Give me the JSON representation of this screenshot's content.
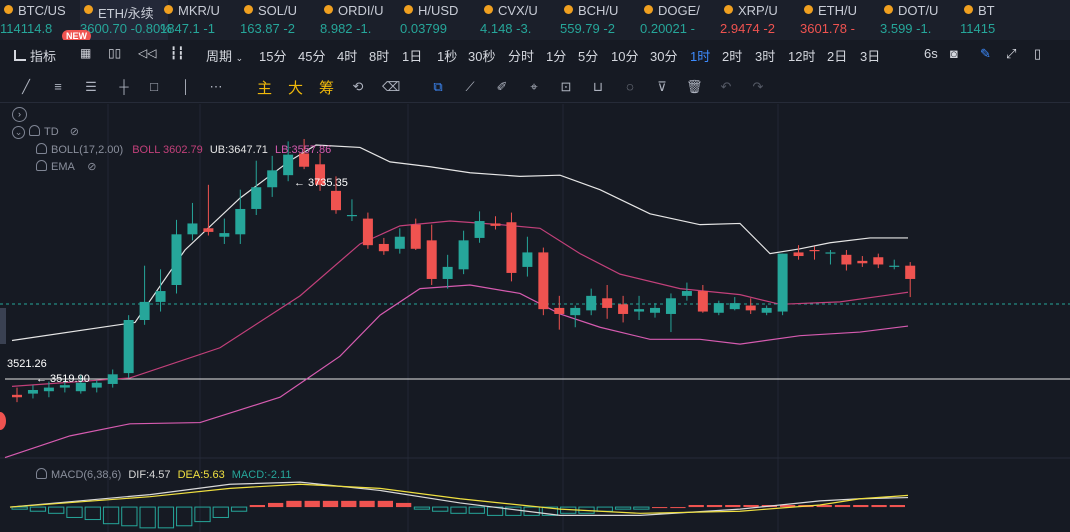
{
  "tickers": [
    {
      "name": "BTC/US",
      "price": "114114.8",
      "change": "",
      "color": "up",
      "active": false
    },
    {
      "name": "ETH/永续",
      "price": "3600.70",
      "change": "-0.80%",
      "color": "up",
      "active": true
    },
    {
      "name": "MKR/U",
      "price": "1847.1",
      "change": "-1",
      "color": "up",
      "active": false
    },
    {
      "name": "SOL/U",
      "price": "163.87",
      "change": "-2",
      "color": "up",
      "active": false
    },
    {
      "name": "ORDI/U",
      "price": "8.982",
      "change": "-1.",
      "color": "up",
      "active": false
    },
    {
      "name": "H/USD",
      "price": "0.03799",
      "change": "",
      "color": "up",
      "active": false
    },
    {
      "name": "CVX/U",
      "price": "4.148",
      "change": "-3.",
      "color": "up",
      "active": false
    },
    {
      "name": "BCH/U",
      "price": "559.79",
      "change": "-2",
      "color": "up",
      "active": false
    },
    {
      "name": "DOGE/",
      "price": "0.20021",
      "change": "-",
      "color": "up",
      "active": false
    },
    {
      "name": "XRP/U",
      "price": "2.9474",
      "change": "-2",
      "color": "dn",
      "active": false
    },
    {
      "name": "ETH/U",
      "price": "3601.78",
      "change": "-",
      "color": "dn",
      "active": false
    },
    {
      "name": "DOT/U",
      "price": "3.599",
      "change": "-1.",
      "color": "up",
      "active": false
    },
    {
      "name": "BT",
      "price": "11415",
      "change": "",
      "color": "up",
      "active": false
    }
  ],
  "new_badge": "NEW",
  "toolbar": {
    "indicators": "指标",
    "period": "周期",
    "intervals": [
      "15分",
      "45分",
      "4时",
      "8时",
      "1日",
      "1秒",
      "30秒",
      "分时",
      "1分",
      "5分",
      "10分",
      "30分",
      "1时",
      "2时",
      "3时",
      "12时",
      "2日",
      "3日"
    ],
    "selected": "1时",
    "refresh": "6s"
  },
  "drawbar": {
    "zhu": "主",
    "da": "大",
    "chou": "筹"
  },
  "legend": {
    "td": "TD",
    "boll_label": "BOLL(17,2.00)",
    "boll_value": "BOLL 3602.79",
    "ub": "UB:3647.71",
    "lb": "LB:3557.86",
    "ema": "EMA",
    "macd_label": "MACD(6,38,6)",
    "dif": "DIF:4.57",
    "dea": "DEA:5.63",
    "macd": "MACD:-2.11"
  },
  "annotations": {
    "high": "← 3735.35",
    "low": "← 3519.90",
    "price_left": "3521.26"
  },
  "colors": {
    "up": "#26a69a",
    "down": "#ef5350",
    "boll_mid": "#c2407a",
    "boll_lb": "#d65bb0",
    "boll_ub": "#e6e6e6",
    "dea": "#f0e040",
    "dif": "#d9d9d9",
    "accent": "#3d8bfd"
  },
  "chart_data": {
    "type": "candlestick",
    "candles": [
      {
        "o": 3524,
        "h": 3530,
        "l": 3518,
        "c": 3522
      },
      {
        "o": 3525,
        "h": 3532,
        "l": 3521,
        "c": 3528
      },
      {
        "o": 3527,
        "h": 3535,
        "l": 3522,
        "c": 3530
      },
      {
        "o": 3530,
        "h": 3536,
        "l": 3526,
        "c": 3532
      },
      {
        "o": 3527,
        "h": 3540,
        "l": 3525,
        "c": 3534
      },
      {
        "o": 3530,
        "h": 3536,
        "l": 3526,
        "c": 3534
      },
      {
        "o": 3533,
        "h": 3545,
        "l": 3530,
        "c": 3541
      },
      {
        "o": 3542,
        "h": 3590,
        "l": 3538,
        "c": 3586
      },
      {
        "o": 3586,
        "h": 3631,
        "l": 3582,
        "c": 3601
      },
      {
        "o": 3601,
        "h": 3628,
        "l": 3593,
        "c": 3610
      },
      {
        "o": 3615,
        "h": 3669,
        "l": 3608,
        "c": 3657
      },
      {
        "o": 3657,
        "h": 3683,
        "l": 3652,
        "c": 3666
      },
      {
        "o": 3662,
        "h": 3698,
        "l": 3656,
        "c": 3659
      },
      {
        "o": 3655,
        "h": 3670,
        "l": 3649,
        "c": 3658
      },
      {
        "o": 3657,
        "h": 3694,
        "l": 3649,
        "c": 3678
      },
      {
        "o": 3678,
        "h": 3718,
        "l": 3673,
        "c": 3696
      },
      {
        "o": 3696,
        "h": 3722,
        "l": 3688,
        "c": 3710
      },
      {
        "o": 3706,
        "h": 3734,
        "l": 3701,
        "c": 3723
      },
      {
        "o": 3724,
        "h": 3736,
        "l": 3711,
        "c": 3713
      },
      {
        "o": 3715,
        "h": 3724,
        "l": 3693,
        "c": 3698
      },
      {
        "o": 3693,
        "h": 3705,
        "l": 3674,
        "c": 3677
      },
      {
        "o": 3672,
        "h": 3686,
        "l": 3668,
        "c": 3673
      },
      {
        "o": 3670,
        "h": 3675,
        "l": 3645,
        "c": 3648
      },
      {
        "o": 3649,
        "h": 3654,
        "l": 3640,
        "c": 3643
      },
      {
        "o": 3645,
        "h": 3662,
        "l": 3641,
        "c": 3655
      },
      {
        "o": 3665,
        "h": 3670,
        "l": 3644,
        "c": 3645
      },
      {
        "o": 3652,
        "h": 3665,
        "l": 3615,
        "c": 3620
      },
      {
        "o": 3620,
        "h": 3640,
        "l": 3612,
        "c": 3630
      },
      {
        "o": 3628,
        "h": 3660,
        "l": 3624,
        "c": 3652
      },
      {
        "o": 3654,
        "h": 3676,
        "l": 3650,
        "c": 3668
      },
      {
        "o": 3666,
        "h": 3672,
        "l": 3661,
        "c": 3664
      },
      {
        "o": 3667,
        "h": 3675,
        "l": 3618,
        "c": 3625
      },
      {
        "o": 3630,
        "h": 3655,
        "l": 3622,
        "c": 3642
      },
      {
        "o": 3642,
        "h": 3646,
        "l": 3590,
        "c": 3595
      },
      {
        "o": 3596,
        "h": 3606,
        "l": 3578,
        "c": 3591
      },
      {
        "o": 3590,
        "h": 3598,
        "l": 3580,
        "c": 3596
      },
      {
        "o": 3594,
        "h": 3612,
        "l": 3590,
        "c": 3606
      },
      {
        "o": 3604,
        "h": 3615,
        "l": 3587,
        "c": 3596
      },
      {
        "o": 3599,
        "h": 3606,
        "l": 3584,
        "c": 3591
      },
      {
        "o": 3593,
        "h": 3606,
        "l": 3586,
        "c": 3595
      },
      {
        "o": 3592,
        "h": 3600,
        "l": 3588,
        "c": 3596
      },
      {
        "o": 3591,
        "h": 3608,
        "l": 3576,
        "c": 3604
      },
      {
        "o": 3606,
        "h": 3617,
        "l": 3602,
        "c": 3610
      },
      {
        "o": 3610,
        "h": 3615,
        "l": 3592,
        "c": 3593
      },
      {
        "o": 3592,
        "h": 3602,
        "l": 3590,
        "c": 3600
      },
      {
        "o": 3595,
        "h": 3605,
        "l": 3594,
        "c": 3600
      },
      {
        "o": 3598,
        "h": 3604,
        "l": 3591,
        "c": 3594
      },
      {
        "o": 3592,
        "h": 3598,
        "l": 3590,
        "c": 3596
      },
      {
        "o": 3593,
        "h": 3641,
        "l": 3590,
        "c": 3641
      },
      {
        "o": 3642,
        "h": 3648,
        "l": 3636,
        "c": 3639
      },
      {
        "o": 3644,
        "h": 3647,
        "l": 3636,
        "c": 3643
      },
      {
        "o": 3641,
        "h": 3644,
        "l": 3632,
        "c": 3642
      },
      {
        "o": 3640,
        "h": 3644,
        "l": 3627,
        "c": 3632
      },
      {
        "o": 3635,
        "h": 3639,
        "l": 3630,
        "c": 3633
      },
      {
        "o": 3638,
        "h": 3641,
        "l": 3629,
        "c": 3632
      },
      {
        "o": 3630,
        "h": 3636,
        "l": 3628,
        "c": 3631
      },
      {
        "o": 3631,
        "h": 3634,
        "l": 3605,
        "c": 3620
      }
    ],
    "boll_ub": [
      [
        12,
        3569
      ],
      [
        135,
        3584
      ],
      [
        185,
        3644
      ],
      [
        240,
        3687
      ],
      [
        290,
        3718
      ],
      [
        316,
        3731
      ],
      [
        360,
        3729
      ],
      [
        390,
        3717
      ],
      [
        430,
        3713
      ],
      [
        470,
        3708
      ],
      [
        520,
        3705
      ],
      [
        560,
        3706
      ],
      [
        600,
        3694
      ],
      [
        650,
        3674
      ],
      [
        700,
        3665
      ],
      [
        740,
        3666
      ],
      [
        770,
        3641
      ],
      [
        800,
        3645
      ],
      [
        830,
        3650
      ],
      [
        870,
        3654
      ],
      [
        908,
        3654
      ]
    ],
    "boll_mid": [
      [
        12,
        3531
      ],
      [
        130,
        3538
      ],
      [
        220,
        3563
      ],
      [
        300,
        3606
      ],
      [
        360,
        3649
      ],
      [
        400,
        3664
      ],
      [
        450,
        3668
      ],
      [
        500,
        3665
      ],
      [
        540,
        3662
      ],
      [
        580,
        3641
      ],
      [
        620,
        3624
      ],
      [
        680,
        3612
      ],
      [
        740,
        3607
      ],
      [
        780,
        3599
      ],
      [
        840,
        3601
      ],
      [
        908,
        3609
      ]
    ],
    "boll_lb": [
      [
        5,
        3472
      ],
      [
        70,
        3490
      ],
      [
        130,
        3500
      ],
      [
        200,
        3501
      ],
      [
        280,
        3522
      ],
      [
        340,
        3556
      ],
      [
        380,
        3590
      ],
      [
        420,
        3612
      ],
      [
        470,
        3615
      ],
      [
        520,
        3608
      ],
      [
        560,
        3591
      ],
      [
        600,
        3580
      ],
      [
        650,
        3570
      ],
      [
        700,
        3570
      ],
      [
        740,
        3566
      ],
      [
        800,
        3573
      ],
      [
        860,
        3576
      ],
      [
        908,
        3581
      ]
    ],
    "macd_hist": [
      -1,
      -2,
      -3,
      -5,
      -6,
      -8,
      -9,
      -10,
      -10,
      -9,
      -7,
      -5,
      -2,
      1,
      2,
      3,
      3,
      3,
      3,
      3,
      3,
      2,
      -1,
      -2,
      -3,
      -3,
      -4,
      -4,
      -4,
      -4,
      -3,
      -3,
      -2,
      -1,
      -1,
      0,
      0,
      1,
      1,
      1,
      1,
      1,
      1,
      1,
      1,
      1,
      1,
      1,
      1
    ],
    "dif": [
      [
        10,
        0
      ],
      [
        150,
        6
      ],
      [
        230,
        11
      ],
      [
        300,
        12
      ],
      [
        380,
        8
      ],
      [
        460,
        2
      ],
      [
        560,
        -4
      ],
      [
        640,
        -4
      ],
      [
        740,
        -1
      ],
      [
        820,
        3
      ],
      [
        860,
        4
      ],
      [
        908,
        4.57
      ]
    ],
    "dea": [
      [
        10,
        0
      ],
      [
        150,
        5
      ],
      [
        230,
        9
      ],
      [
        300,
        11
      ],
      [
        380,
        9
      ],
      [
        460,
        4
      ],
      [
        560,
        -1
      ],
      [
        640,
        -3
      ],
      [
        740,
        -2
      ],
      [
        820,
        1
      ],
      [
        860,
        4
      ],
      [
        908,
        5.63
      ]
    ],
    "ylim": [
      3470,
      3760
    ],
    "macd_ylim": [
      -12,
      14
    ]
  }
}
